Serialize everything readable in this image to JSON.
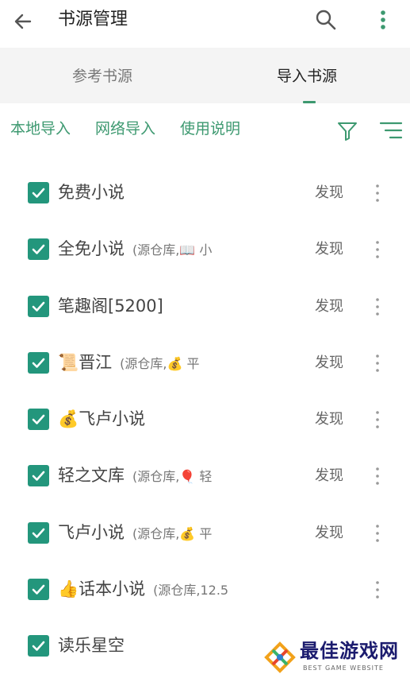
{
  "header": {
    "title": "书源管理",
    "back_icon": "arrow-back-icon",
    "search_icon": "search-icon",
    "more_icon": "more-vert-icon"
  },
  "tabs": [
    {
      "label": "参考书源"
    },
    {
      "label": "导入书源",
      "active": true
    }
  ],
  "actions": {
    "local_import": "本地导入",
    "network_import": "网络导入",
    "usage": "使用说明",
    "filter_icon": "filter-icon",
    "sort_icon": "sort-icon"
  },
  "colors": {
    "accent": "#3d9970",
    "checkbox": "#23967c"
  },
  "sources": [
    {
      "name": "免费小说",
      "note": "",
      "discover": "发现",
      "checked": true
    },
    {
      "name": "全免小说",
      "note": "(源仓库,📖 小",
      "discover": "发现",
      "checked": true
    },
    {
      "name": "笔趣阁[5200]",
      "note": "",
      "discover": "发现",
      "checked": true
    },
    {
      "name": "📜晋江",
      "note": "(源仓库,💰 平",
      "discover": "发现",
      "checked": true
    },
    {
      "name": "💰飞卢小说",
      "note": "",
      "discover": "发现",
      "checked": true
    },
    {
      "name": "轻之文库",
      "note": "(源仓库,🎈 轻",
      "discover": "发现",
      "checked": true
    },
    {
      "name": "飞卢小说",
      "note": "(源仓库,💰 平",
      "discover": "发现",
      "checked": true
    },
    {
      "name": "👍话本小说",
      "note": "(源仓库,12.5",
      "discover": "",
      "checked": true
    },
    {
      "name": "读乐星空",
      "note": "",
      "discover": "",
      "checked": true
    }
  ],
  "watermark": {
    "cn": "最佳游戏网",
    "en": "BEST GAME WEBSITE"
  }
}
